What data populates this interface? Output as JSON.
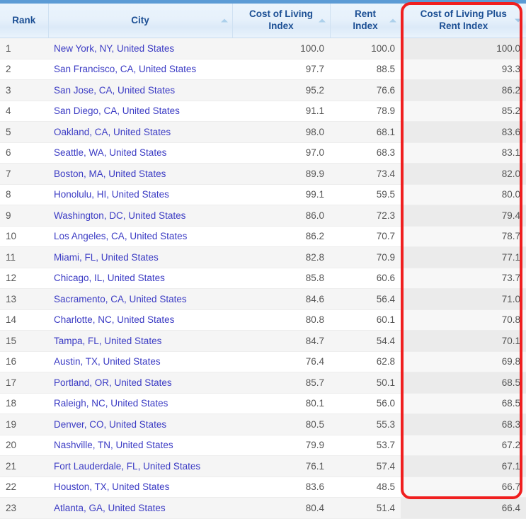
{
  "accent": {
    "top_bar": "#5b9bd5",
    "header_text": "#1c4f94",
    "link": "#3b3bc4",
    "highlight_border": "#f01f1f",
    "row_alt": "#f5f5f5"
  },
  "table": {
    "columns": [
      {
        "label": "Rank",
        "sort": "none",
        "align": "left"
      },
      {
        "label": "City",
        "sort": "asc",
        "align": "left"
      },
      {
        "label": "Cost of Living Index",
        "sort": "asc",
        "align": "right"
      },
      {
        "label": "Rent Index",
        "sort": "asc",
        "align": "right"
      },
      {
        "label": "Cost of Living Plus Rent Index",
        "sort": "desc",
        "align": "right"
      }
    ],
    "rows": [
      {
        "rank": "1",
        "city": "New York, NY, United States",
        "col": "100.0",
        "rent": "100.0",
        "total": "100.0"
      },
      {
        "rank": "2",
        "city": "San Francisco, CA, United States",
        "col": "97.7",
        "rent": "88.5",
        "total": "93.3"
      },
      {
        "rank": "3",
        "city": "San Jose, CA, United States",
        "col": "95.2",
        "rent": "76.6",
        "total": "86.2"
      },
      {
        "rank": "4",
        "city": "San Diego, CA, United States",
        "col": "91.1",
        "rent": "78.9",
        "total": "85.2"
      },
      {
        "rank": "5",
        "city": "Oakland, CA, United States",
        "col": "98.0",
        "rent": "68.1",
        "total": "83.6"
      },
      {
        "rank": "6",
        "city": "Seattle, WA, United States",
        "col": "97.0",
        "rent": "68.3",
        "total": "83.1"
      },
      {
        "rank": "7",
        "city": "Boston, MA, United States",
        "col": "89.9",
        "rent": "73.4",
        "total": "82.0"
      },
      {
        "rank": "8",
        "city": "Honolulu, HI, United States",
        "col": "99.1",
        "rent": "59.5",
        "total": "80.0"
      },
      {
        "rank": "9",
        "city": "Washington, DC, United States",
        "col": "86.0",
        "rent": "72.3",
        "total": "79.4"
      },
      {
        "rank": "10",
        "city": "Los Angeles, CA, United States",
        "col": "86.2",
        "rent": "70.7",
        "total": "78.7"
      },
      {
        "rank": "11",
        "city": "Miami, FL, United States",
        "col": "82.8",
        "rent": "70.9",
        "total": "77.1"
      },
      {
        "rank": "12",
        "city": "Chicago, IL, United States",
        "col": "85.8",
        "rent": "60.6",
        "total": "73.7"
      },
      {
        "rank": "13",
        "city": "Sacramento, CA, United States",
        "col": "84.6",
        "rent": "56.4",
        "total": "71.0"
      },
      {
        "rank": "14",
        "city": "Charlotte, NC, United States",
        "col": "80.8",
        "rent": "60.1",
        "total": "70.8"
      },
      {
        "rank": "15",
        "city": "Tampa, FL, United States",
        "col": "84.7",
        "rent": "54.4",
        "total": "70.1"
      },
      {
        "rank": "16",
        "city": "Austin, TX, United States",
        "col": "76.4",
        "rent": "62.8",
        "total": "69.8"
      },
      {
        "rank": "17",
        "city": "Portland, OR, United States",
        "col": "85.7",
        "rent": "50.1",
        "total": "68.5"
      },
      {
        "rank": "18",
        "city": "Raleigh, NC, United States",
        "col": "80.1",
        "rent": "56.0",
        "total": "68.5"
      },
      {
        "rank": "19",
        "city": "Denver, CO, United States",
        "col": "80.5",
        "rent": "55.3",
        "total": "68.3"
      },
      {
        "rank": "20",
        "city": "Nashville, TN, United States",
        "col": "79.9",
        "rent": "53.7",
        "total": "67.2"
      },
      {
        "rank": "21",
        "city": "Fort Lauderdale, FL, United States",
        "col": "76.1",
        "rent": "57.4",
        "total": "67.1"
      },
      {
        "rank": "22",
        "city": "Houston, TX, United States",
        "col": "83.6",
        "rent": "48.5",
        "total": "66.7"
      },
      {
        "rank": "23",
        "city": "Atlanta, GA, United States",
        "col": "80.4",
        "rent": "51.4",
        "total": "66.4"
      }
    ]
  }
}
